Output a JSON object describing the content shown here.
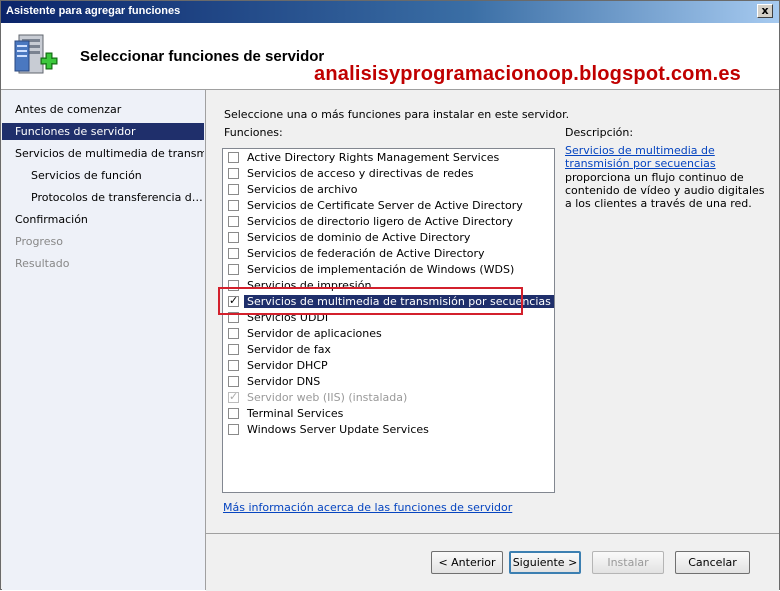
{
  "window": {
    "title": "Asistente para agregar funciones",
    "close_symbol": "x"
  },
  "header": {
    "title": "Seleccionar funciones de servidor",
    "icon": "server-roles-add-icon"
  },
  "watermark": "analisisyprogramacionoop.blogspot.com.es",
  "nav": {
    "items": [
      {
        "label": "Antes de comenzar",
        "state": "normal",
        "indent": 0
      },
      {
        "label": "Funciones de servidor",
        "state": "active",
        "indent": 0
      },
      {
        "label": "Servicios de multimedia de transm…",
        "state": "normal",
        "indent": 0
      },
      {
        "label": "Servicios de función",
        "state": "normal",
        "indent": 1
      },
      {
        "label": "Protocolos de transferencia d…",
        "state": "normal",
        "indent": 1
      },
      {
        "label": "Confirmación",
        "state": "normal",
        "indent": 0
      },
      {
        "label": "Progreso",
        "state": "disabled",
        "indent": 0
      },
      {
        "label": "Resultado",
        "state": "disabled",
        "indent": 0
      }
    ]
  },
  "main": {
    "instruction": "Seleccione una o más funciones para instalar en este servidor.",
    "functions_label": "Funciones:",
    "roles": [
      {
        "label": "Active Directory Rights Management Services",
        "checked": false,
        "disabled": false,
        "selected": false
      },
      {
        "label": "Servicios de acceso y directivas de redes",
        "checked": false,
        "disabled": false,
        "selected": false
      },
      {
        "label": "Servicios de archivo",
        "checked": false,
        "disabled": false,
        "selected": false
      },
      {
        "label": "Servicios de Certificate Server de Active Directory",
        "checked": false,
        "disabled": false,
        "selected": false
      },
      {
        "label": "Servicios de directorio ligero de Active Directory",
        "checked": false,
        "disabled": false,
        "selected": false
      },
      {
        "label": "Servicios de dominio de Active Directory",
        "checked": false,
        "disabled": false,
        "selected": false
      },
      {
        "label": "Servicios de federación de Active Directory",
        "checked": false,
        "disabled": false,
        "selected": false
      },
      {
        "label": "Servicios de implementación de Windows (WDS)",
        "checked": false,
        "disabled": false,
        "selected": false
      },
      {
        "label": "Servicios de impresión",
        "checked": false,
        "disabled": false,
        "selected": false
      },
      {
        "label": "Servicios de multimedia de transmisión por secuencias",
        "checked": true,
        "disabled": false,
        "selected": true
      },
      {
        "label": "Servicios UDDI",
        "checked": false,
        "disabled": false,
        "selected": false
      },
      {
        "label": "Servidor de aplicaciones",
        "checked": false,
        "disabled": false,
        "selected": false
      },
      {
        "label": "Servidor de fax",
        "checked": false,
        "disabled": false,
        "selected": false
      },
      {
        "label": "Servidor DHCP",
        "checked": false,
        "disabled": false,
        "selected": false
      },
      {
        "label": "Servidor DNS",
        "checked": false,
        "disabled": false,
        "selected": false
      },
      {
        "label": "Servidor web (IIS) (instalada)",
        "checked": true,
        "disabled": true,
        "selected": false
      },
      {
        "label": "Terminal Services",
        "checked": false,
        "disabled": false,
        "selected": false
      },
      {
        "label": "Windows Server Update Services",
        "checked": false,
        "disabled": false,
        "selected": false
      }
    ],
    "more_info_link": "Más información acerca de las funciones de servidor"
  },
  "description": {
    "label": "Descripción:",
    "link": "Servicios de multimedia de transmisión por secuencias",
    "text": "proporciona un flujo continuo de contenido de vídeo y audio digitales a los clientes a través de una red."
  },
  "buttons": {
    "back": "< Anterior",
    "next": "Siguiente >",
    "install": "Instalar",
    "cancel": "Cancelar"
  },
  "colors": {
    "selection": "#1f2f6b",
    "highlight_box": "#d3202c",
    "link": "#0645c0",
    "watermark": "#c00000"
  }
}
